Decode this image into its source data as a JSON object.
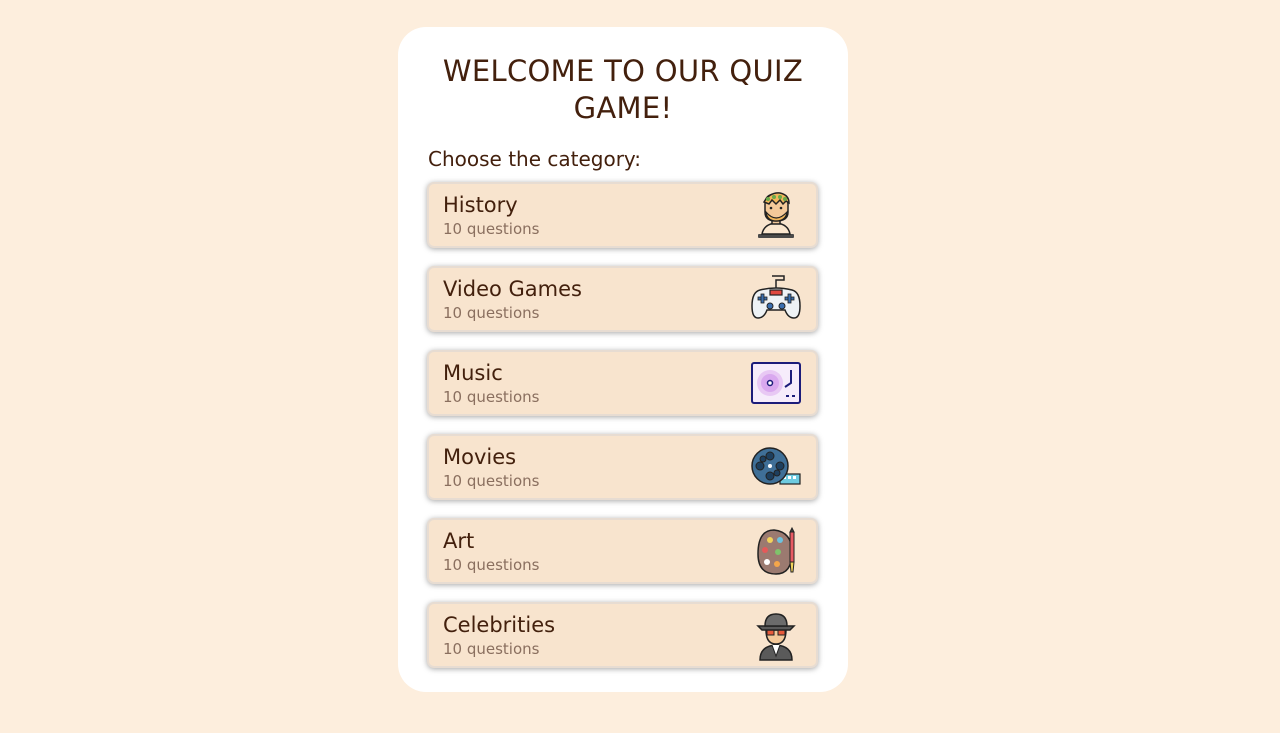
{
  "page": {
    "title": "WELCOME TO OUR QUIZ GAME!",
    "subtitle": "Choose the category:"
  },
  "categories": [
    {
      "name": "History",
      "count": "10 questions",
      "icon": "history-icon"
    },
    {
      "name": "Video Games",
      "count": "10 questions",
      "icon": "gamepad-icon"
    },
    {
      "name": "Music",
      "count": "10 questions",
      "icon": "turntable-icon"
    },
    {
      "name": "Movies",
      "count": "10 questions",
      "icon": "film-reel-icon"
    },
    {
      "name": "Art",
      "count": "10 questions",
      "icon": "palette-icon"
    },
    {
      "name": "Celebrities",
      "count": "10 questions",
      "icon": "celebrity-icon"
    }
  ],
  "colors": {
    "background": "#fdeedd",
    "card": "#ffffff",
    "item": "#f8e4ce",
    "text": "#43200d",
    "muted": "#8a6f5f"
  }
}
